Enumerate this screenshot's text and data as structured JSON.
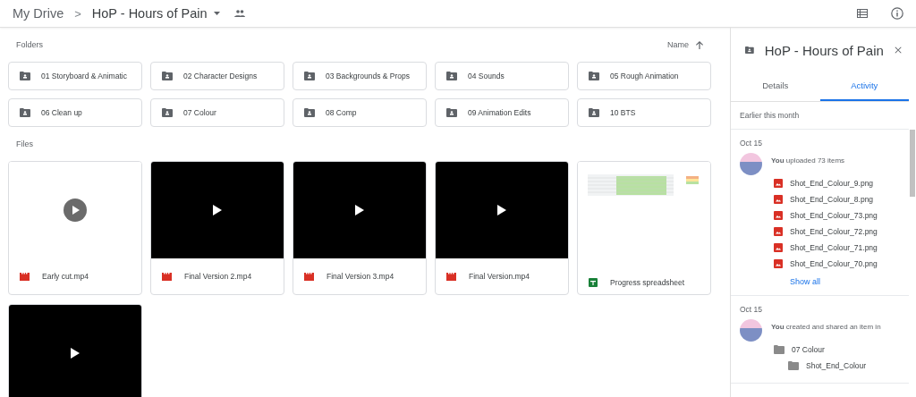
{
  "breadcrumb": {
    "root": "My Drive",
    "separator": ">",
    "current": "HoP - Hours of Pain"
  },
  "folders_section": {
    "title": "Folders",
    "sort": {
      "label": "Name"
    }
  },
  "folders": [
    {
      "name": "01 Storyboard & Animatic"
    },
    {
      "name": "02 Character Designs"
    },
    {
      "name": "03 Backgrounds & Props"
    },
    {
      "name": "04 Sounds"
    },
    {
      "name": "05 Rough Animation"
    },
    {
      "name": "06 Clean up"
    },
    {
      "name": "07 Colour"
    },
    {
      "name": "08 Comp"
    },
    {
      "name": "09 Animation Edits"
    },
    {
      "name": "10 BTS"
    }
  ],
  "files_section": {
    "title": "Files"
  },
  "files": [
    {
      "name": "Early cut.mp4",
      "kind": "video",
      "preview": {
        "kind": "blank"
      }
    },
    {
      "name": "Final Version 2.mp4",
      "kind": "video",
      "preview": {
        "kind": "frame"
      }
    },
    {
      "name": "Final Version 3.mp4",
      "kind": "video",
      "preview": {
        "kind": "frame"
      }
    },
    {
      "name": "Final Version.mp4",
      "kind": "video",
      "preview": {
        "kind": "frame"
      }
    },
    {
      "name": "Progress spreadsheet",
      "kind": "sheet",
      "preview": {
        "kind": "sheet"
      }
    },
    {
      "kind": "video",
      "preview": {
        "kind": "frame"
      }
    }
  ],
  "panel": {
    "title": "HoP - Hours of Pain",
    "tabs": [
      {
        "label": "Details",
        "selected": false
      },
      {
        "label": "Activity",
        "selected": true
      }
    ],
    "period": "Earlier this month",
    "activities": [
      {
        "date": "Oct 15",
        "actor": "You",
        "action": "uploaded 73 items",
        "items": [
          {
            "name": "Shot_End_Colour_9.png",
            "kind": "image"
          },
          {
            "name": "Shot_End_Colour_8.png",
            "kind": "image"
          },
          {
            "name": "Shot_End_Colour_73.png",
            "kind": "image"
          },
          {
            "name": "Shot_End_Colour_72.png",
            "kind": "image"
          },
          {
            "name": "Shot_End_Colour_71.png",
            "kind": "image"
          },
          {
            "name": "Shot_End_Colour_70.png",
            "kind": "image"
          }
        ],
        "more": "Show all"
      },
      {
        "date": "Oct 15",
        "actor": "You",
        "action": "created and shared an item in",
        "items": [
          {
            "name": "07 Colour",
            "kind": "folder",
            "children": [
              {
                "name": "Shot_End_Colour",
                "kind": "folder"
              }
            ]
          }
        ]
      }
    ]
  }
}
